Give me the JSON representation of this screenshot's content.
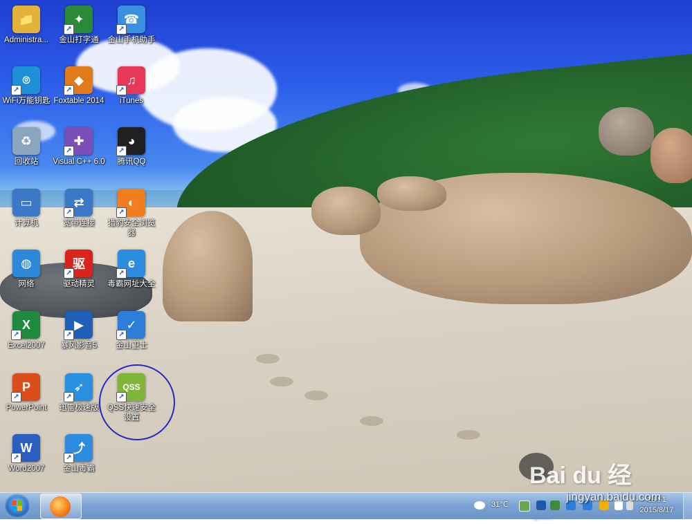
{
  "desktop": {
    "icons": [
      {
        "name": "administrator-folder",
        "label": "Administra...",
        "color": "#e2b23b",
        "glyph": "📁",
        "shortcut": false
      },
      {
        "name": "jinshan-typing",
        "label": "金山打字通",
        "color": "#2a8a3a",
        "glyph": "✦",
        "shortcut": true
      },
      {
        "name": "jinshan-phone-helper",
        "label": "金山手机助手",
        "color": "#3a8fe0",
        "glyph": "☎",
        "shortcut": true
      },
      {
        "name": "wifi-key",
        "label": "WiFi万能钥匙",
        "color": "#1e90d8",
        "glyph": "⌾",
        "shortcut": true
      },
      {
        "name": "foxtable",
        "label": "Foxtable 2014",
        "color": "#e07a1a",
        "glyph": "◆",
        "shortcut": true
      },
      {
        "name": "itunes",
        "label": "iTunes",
        "color": "#e8385a",
        "glyph": "♫",
        "shortcut": true
      },
      {
        "name": "recycle-bin",
        "label": "回收站",
        "color": "#8ba5bf",
        "glyph": "♻",
        "shortcut": false
      },
      {
        "name": "visual-cpp",
        "label": "Visual C++ 6.0",
        "color": "#7a4fb8",
        "glyph": "✚",
        "shortcut": true
      },
      {
        "name": "tencent-qq",
        "label": "腾讯QQ",
        "color": "#202020",
        "glyph": "◕",
        "shortcut": true
      },
      {
        "name": "computer",
        "label": "计算机",
        "color": "#3b78c8",
        "glyph": "▭",
        "shortcut": false
      },
      {
        "name": "broadband-connect",
        "label": "宽带连接",
        "color": "#3b78c8",
        "glyph": "⇄",
        "shortcut": true
      },
      {
        "name": "liebao-browser",
        "label": "猎豹安全浏览器",
        "color": "#f07d1e",
        "glyph": "◐",
        "shortcut": true
      },
      {
        "name": "network",
        "label": "网络",
        "color": "#2c88d8",
        "glyph": "◍",
        "shortcut": false
      },
      {
        "name": "driver-genius",
        "label": "驱动精灵",
        "color": "#d8241d",
        "glyph": "驱",
        "shortcut": true
      },
      {
        "name": "duba-nav",
        "label": "毒霸网址大全",
        "color": "#2d8be0",
        "glyph": "e",
        "shortcut": true
      },
      {
        "name": "excel2007",
        "label": "Excel2007",
        "color": "#1f8a3d",
        "glyph": "X",
        "shortcut": true
      },
      {
        "name": "baofeng-player",
        "label": "暴风影音5",
        "color": "#1f5fb8",
        "glyph": "▶",
        "shortcut": true
      },
      {
        "name": "jinshan-guard",
        "label": "金山卫士",
        "color": "#2d7ed8",
        "glyph": "✓",
        "shortcut": true
      },
      {
        "name": "powerpoint",
        "label": "PowerPoint",
        "color": "#d94d1d",
        "glyph": "P",
        "shortcut": true
      },
      {
        "name": "xunlei",
        "label": "迅雷极速版",
        "color": "#2a8fe0",
        "glyph": "➶",
        "shortcut": true
      },
      {
        "name": "qss-quick-security",
        "label": "QSS快速安全设置",
        "color": "#7fb63a",
        "glyph": "QSS",
        "shortcut": true
      },
      {
        "name": "word2007",
        "label": "Word2007",
        "color": "#2a5fbf",
        "glyph": "W",
        "shortcut": true
      },
      {
        "name": "jinshan-duba",
        "label": "金山毒霸",
        "color": "#2d8be0",
        "glyph": "⤴",
        "shortcut": true
      }
    ]
  },
  "watermark": {
    "brand": "Bai du 经验",
    "url": "jingyan.baidu.com"
  },
  "taskbar": {
    "start_label": "Start",
    "weather": "31℃",
    "clock": {
      "time": "13:51",
      "date": "2015/8/17"
    }
  },
  "colors": {
    "circle": "#2727c8",
    "taskbar": "#7ea4d4"
  }
}
